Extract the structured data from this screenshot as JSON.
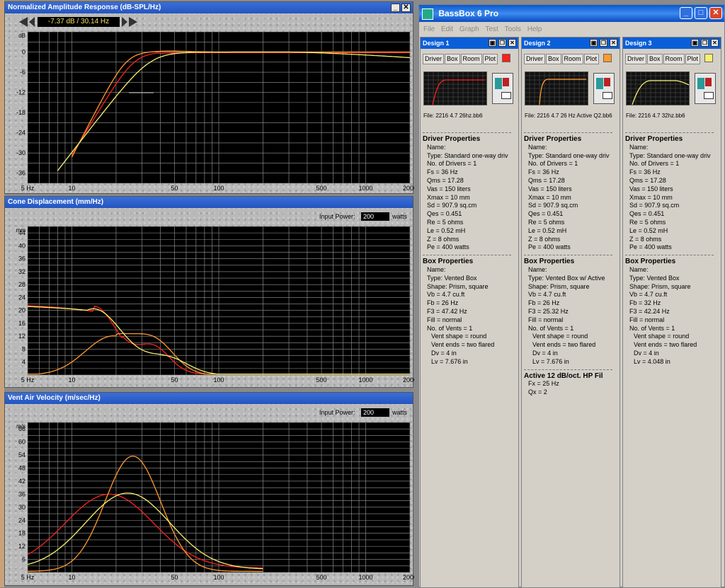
{
  "colors": {
    "design1": "#ff2020",
    "design2": "#ff9a30",
    "design3": "#f7f070",
    "grid": "#9a9a9a",
    "plot_bg": "#000000"
  },
  "amp": {
    "title": "Normalized Amplitude Response (dB-SPL/Hz)",
    "readout": "-7.37 dB / 30.14 Hz",
    "unit": "dB",
    "yticks": [
      "0",
      "-6",
      "-12",
      "-18",
      "-24",
      "-30",
      "-36"
    ],
    "xticks": [
      "5 Hz",
      "10",
      "50",
      "100",
      "500",
      "1000",
      "2000"
    ]
  },
  "cone": {
    "title": "Cone Displacement (mm/Hz)",
    "input_power_label": "Input Power:",
    "input_power": "200",
    "watts": "watts",
    "unit": "mm",
    "yticks": [
      "44",
      "40",
      "36",
      "32",
      "28",
      "24",
      "20",
      "16",
      "12",
      "8",
      "4"
    ],
    "xticks": [
      "5 Hz",
      "10",
      "50",
      "100",
      "500",
      "1000",
      "2000"
    ]
  },
  "vent": {
    "title": "Vent Air Velocity (m/sec/Hz)",
    "input_power_label": "Input Power:",
    "input_power": "200",
    "watts": "watts",
    "unit": "m/s",
    "yticks": [
      "66",
      "60",
      "54",
      "48",
      "42",
      "36",
      "30",
      "24",
      "18",
      "12",
      "6"
    ],
    "xticks": [
      "5 Hz",
      "10",
      "50",
      "100",
      "500",
      "1000",
      "2000"
    ]
  },
  "bassbox": {
    "title": "BassBox 6 Pro",
    "menu": [
      "File",
      "Edit",
      "Graph",
      "Test",
      "Tools",
      "Help"
    ],
    "tabs": [
      "Driver",
      "Box",
      "Room",
      "Plot"
    ],
    "designs": [
      {
        "title": "Design 1",
        "file": "File: 2216 4.7 26hz.bb6",
        "driver_header": "Driver Properties",
        "driver": [
          "Name:",
          "Type: Standard one-way driv",
          "No. of Drivers = 1",
          "Fs = 36 Hz",
          "Qms = 17.28",
          "Vas = 150 liters",
          "Xmax = 10 mm",
          "Sd = 907.9 sq.cm",
          "Qes = 0.451",
          "Re = 5 ohms",
          "Le = 0.52 mH",
          "Z = 8 ohms",
          "Pe = 400 watts"
        ],
        "box_header": "Box Properties",
        "box": [
          "Name:",
          "Type: Vented Box",
          "Shape: Prism, square",
          "Vb = 4.7 cu.ft",
          "Fb = 26 Hz",
          "F3 = 47.42 Hz",
          "Fill = normal",
          "No. of Vents = 1"
        ],
        "vent": [
          "Vent shape = round",
          "Vent ends = two flared",
          "Dv = 4 in",
          "Lv = 7.676 in"
        ]
      },
      {
        "title": "Design 2",
        "file": "File: 2216 4.7 26 Hz Active Q2.bb6",
        "driver_header": "Driver Properties",
        "driver": [
          "Name:",
          "Type: Standard one-way driv",
          "No. of Drivers = 1",
          "Fs = 36 Hz",
          "Qms = 17.28",
          "Vas = 150 liters",
          "Xmax = 10 mm",
          "Sd = 907.9 sq.cm",
          "Qes = 0.451",
          "Re = 5 ohms",
          "Le = 0.52 mH",
          "Z = 8 ohms",
          "Pe = 400 watts"
        ],
        "box_header": "Box Properties",
        "box": [
          "Name:",
          "Type: Vented Box w/ Active",
          "Shape: Prism, square",
          "Vb = 4.7 cu.ft",
          "Fb = 26 Hz",
          "F3 = 25.32 Hz",
          "Fill = normal",
          "No. of Vents = 1"
        ],
        "vent": [
          "Vent shape = round",
          "Vent ends = two flared",
          "Dv = 4 in",
          "Lv = 7.676 in"
        ],
        "active_header": "Active 12 dB/oct. HP Fil",
        "active": [
          "Fx = 25 Hz",
          "Qx = 2"
        ]
      },
      {
        "title": "Design 3",
        "file": "File: 2216 4.7 32hz.bb6",
        "driver_header": "Driver Properties",
        "driver": [
          "Name:",
          "Type: Standard one-way driv",
          "No. of Drivers = 1",
          "Fs = 36 Hz",
          "Qms = 17.28",
          "Vas = 150 liters",
          "Xmax = 10 mm",
          "Sd = 907.9 sq.cm",
          "Qes = 0.451",
          "Re = 5 ohms",
          "Le = 0.52 mH",
          "Z = 8 ohms",
          "Pe = 400 watts"
        ],
        "box_header": "Box Properties",
        "box": [
          "Name:",
          "Type: Vented Box",
          "Shape: Prism, square",
          "Vb = 4.7 cu.ft",
          "Fb = 32 Hz",
          "F3 = 42.24 Hz",
          "Fill = normal",
          "No. of Vents = 1"
        ],
        "vent": [
          "Vent shape = round",
          "Vent ends = two flared",
          "Dv = 4 in",
          "Lv = 4.048 in"
        ]
      }
    ]
  }
}
